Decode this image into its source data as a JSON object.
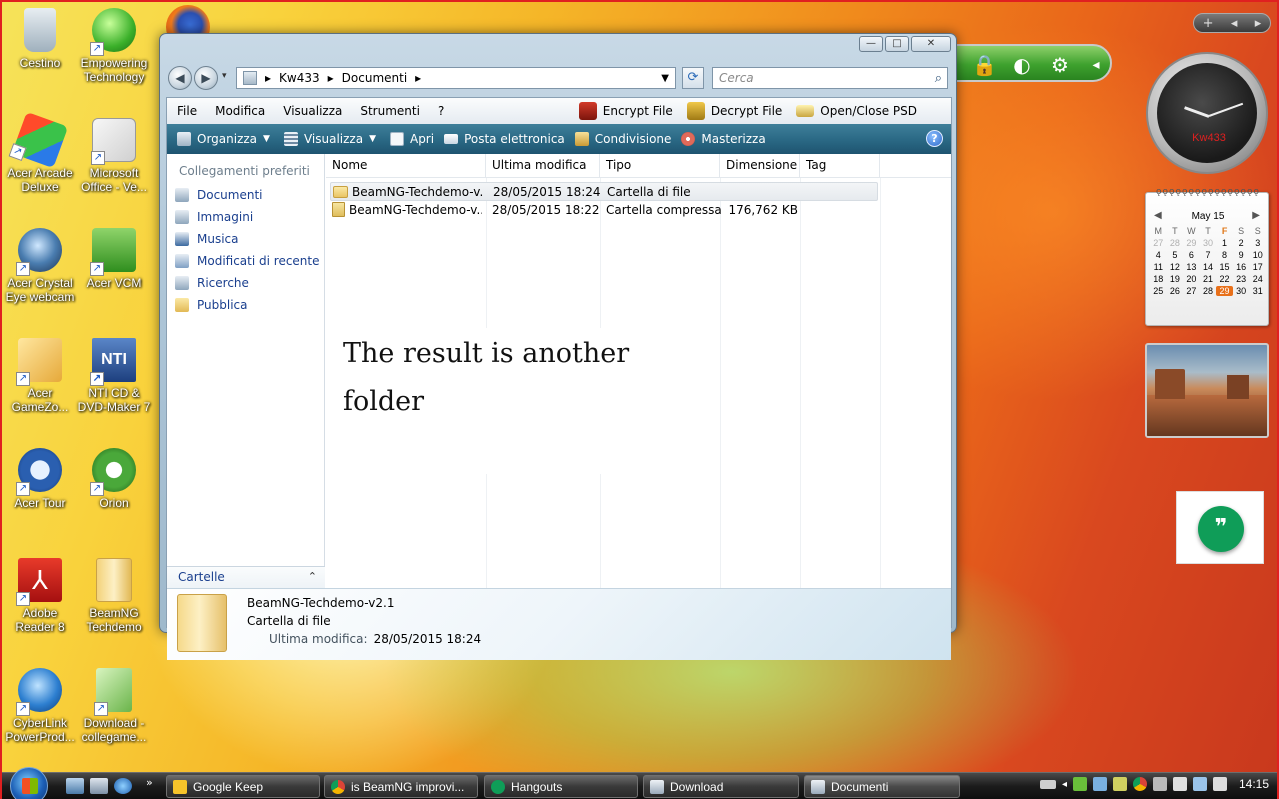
{
  "desktop": {
    "icons": [
      {
        "label": "Cestino"
      },
      {
        "label": "Empowering Technology"
      },
      {
        "label": "Acer Arcade Deluxe"
      },
      {
        "label": "Microsoft Office - Ve..."
      },
      {
        "label": "Acer Crystal Eye webcam"
      },
      {
        "label": "Acer VCM"
      },
      {
        "label": "Acer GameZo..."
      },
      {
        "label": "NTI CD & DVD-Maker 7"
      },
      {
        "label": "Acer Tour"
      },
      {
        "label": "Orion"
      },
      {
        "label": "Adobe Reader 8"
      },
      {
        "label": "BeamNG Techdemo"
      },
      {
        "label": "CyberLink PowerProd..."
      },
      {
        "label": "Download - collegame..."
      }
    ],
    "icon_names": [
      "recycle-bin-icon",
      "empowering-tech-icon",
      "acer-arcade-icon",
      "ms-office-icon",
      "webcam-icon",
      "acer-vcm-icon",
      "gamezone-icon",
      "nti-icon",
      "acer-tour-icon",
      "orion-icon",
      "adobe-reader-icon",
      "beamng-folder-icon",
      "cyberlink-icon",
      "download-shortcut-icon"
    ]
  },
  "window": {
    "controls": {
      "minimize": "—",
      "maximize": "□",
      "close": "✕"
    },
    "address": {
      "segments": [
        "Kw433",
        "Documenti"
      ],
      "separator": "▸"
    },
    "search": {
      "placeholder": "Cerca"
    },
    "menu": [
      "File",
      "Modifica",
      "Visualizza",
      "Strumenti",
      "?"
    ],
    "tools": [
      {
        "label": "Encrypt File",
        "icon": "lock-red-icon"
      },
      {
        "label": "Decrypt File",
        "icon": "lock-gold-icon"
      },
      {
        "label": "Open/Close PSD",
        "icon": "drive-icon"
      }
    ],
    "commands": [
      {
        "label": "Organizza",
        "dropdown": true
      },
      {
        "label": "Visualizza",
        "dropdown": true
      },
      {
        "label": "Apri",
        "dropdown": false
      },
      {
        "label": "Posta elettronica",
        "dropdown": false
      },
      {
        "label": "Condivisione",
        "dropdown": false
      },
      {
        "label": "Masterizza",
        "dropdown": false
      }
    ],
    "help": "?",
    "favorites": {
      "header": "Collegamenti preferiti",
      "items": [
        "Documenti",
        "Immagini",
        "Musica",
        "Modificati di recente",
        "Ricerche",
        "Pubblica"
      ]
    },
    "folders_label": "Cartelle",
    "columns": [
      "Nome",
      "Ultima modifica",
      "Tipo",
      "Dimensione",
      "Tag"
    ],
    "files": [
      {
        "name": "BeamNG-Techdemo-v...",
        "modified": "28/05/2015 18:24",
        "type": "Cartella di file",
        "size": "",
        "tag": ""
      },
      {
        "name": "BeamNG-Techdemo-v...",
        "modified": "28/05/2015 18:22",
        "type": "Cartella compressa",
        "size": "176,762 KB",
        "tag": ""
      }
    ],
    "note_lines": [
      "The result is another",
      "folder"
    ],
    "details": {
      "name": "BeamNG-Techdemo-v2.1",
      "type": "Cartella di file",
      "modified_label": "Ultima modifica:",
      "modified_value": "28/05/2015 18:24"
    }
  },
  "gadgets": {
    "clock_label": "Kw433",
    "calendar": {
      "title": "May 15",
      "day_headers": [
        "M",
        "T",
        "W",
        "T",
        "F",
        "S",
        "S"
      ],
      "weeks": [
        [
          "27",
          "28",
          "29",
          "30",
          "1",
          "2",
          "3"
        ],
        [
          "4",
          "5",
          "6",
          "7",
          "8",
          "9",
          "10"
        ],
        [
          "11",
          "12",
          "13",
          "14",
          "15",
          "16",
          "17"
        ],
        [
          "18",
          "19",
          "20",
          "21",
          "22",
          "23",
          "24"
        ],
        [
          "25",
          "26",
          "27",
          "28",
          "29",
          "30",
          "31"
        ]
      ],
      "today": "29"
    },
    "sidebar_controls": [
      "+",
      "◂",
      "▸"
    ]
  },
  "taskbar": {
    "buttons": [
      {
        "label": "Google Keep",
        "icon": "keep-icon"
      },
      {
        "label": "is BeamNG improvi...",
        "icon": "chrome-icon"
      },
      {
        "label": "Hangouts",
        "icon": "hangouts-icon"
      },
      {
        "label": "Download",
        "icon": "explorer-folder-icon"
      },
      {
        "label": "Documenti",
        "icon": "explorer-folder-icon"
      }
    ],
    "time": "14:15"
  },
  "colors": {
    "cmdbar": "#2b6a86",
    "hangouts_green": "#0f9d58",
    "calendar_today": "#e8701a",
    "link_blue": "#1a3f8e"
  }
}
